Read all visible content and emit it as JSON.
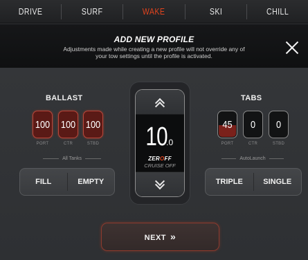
{
  "tabs": [
    "DRIVE",
    "SURF",
    "WAKE",
    "SKI",
    "CHILL"
  ],
  "active_tab": "WAKE",
  "banner": {
    "title": "ADD NEW PROFILE",
    "subtitle": "Adjustments made while creating a new profile will not override any of your tow settings until the profile is activated."
  },
  "ballast": {
    "title": "BALLAST",
    "tanks": [
      {
        "value": "100",
        "label": "PORT",
        "level": 1.0
      },
      {
        "value": "100",
        "label": "CTR",
        "level": 1.0
      },
      {
        "value": "100",
        "label": "STBD",
        "level": 1.0
      }
    ],
    "group_caption": "All Tanks",
    "buttons": [
      "FILL",
      "EMPTY"
    ]
  },
  "speed": {
    "value": "10",
    "decimal": ".0",
    "brand_pre": "ZER",
    "brand_o": "O",
    "brand_post": "FF",
    "status": "CRUISE OFF"
  },
  "tabs_panel": {
    "title": "TABS",
    "tabs": [
      {
        "value": "45",
        "label": "PORT",
        "level": 0.45
      },
      {
        "value": "0",
        "label": "CTR",
        "level": 0.0
      },
      {
        "value": "0",
        "label": "STBD",
        "level": 0.0
      }
    ],
    "group_caption": "AutoLaunch",
    "buttons": [
      "TRIPLE",
      "SINGLE"
    ]
  },
  "next_label": "NEXT",
  "colors": {
    "accent": "#e0431e",
    "fill": "#7a211b",
    "background": "#323437"
  }
}
